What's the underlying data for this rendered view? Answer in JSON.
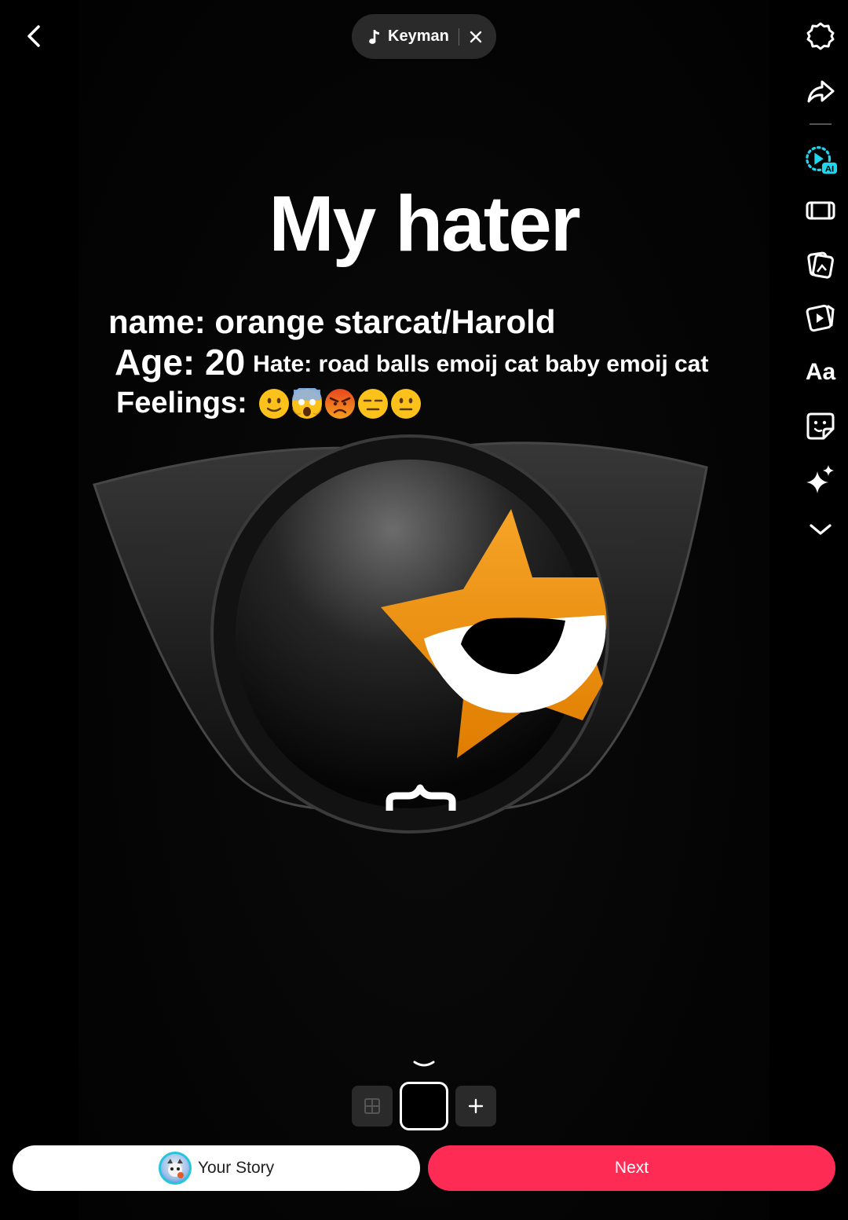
{
  "music": {
    "song": "Keyman"
  },
  "title": "My hater",
  "info": {
    "name_line": "name: orange starcat/Harold",
    "age_line": "Age: 20",
    "hate_line": "Hate: road balls emoij cat baby emoij cat",
    "feelings_label": "Feelings:",
    "feelings_emojis": [
      "slightly-smiling-face",
      "screaming-face",
      "angry-face",
      "expressionless-face",
      "neutral-face"
    ]
  },
  "right_rail": [
    "settings-icon",
    "share-icon",
    "ai-effect-icon",
    "clip-icon",
    "image-icon",
    "template-icon",
    "text-icon",
    "sticker-icon",
    "effects-icon",
    "more-icon"
  ],
  "rail_text": {
    "text_tool": "Aa"
  },
  "bottom": {
    "your_story_label": "Your Story",
    "next_label": "Next"
  },
  "colors": {
    "accent": "#fe2c55",
    "star": "#f08c0a",
    "ai_teal": "#20d5ec"
  }
}
